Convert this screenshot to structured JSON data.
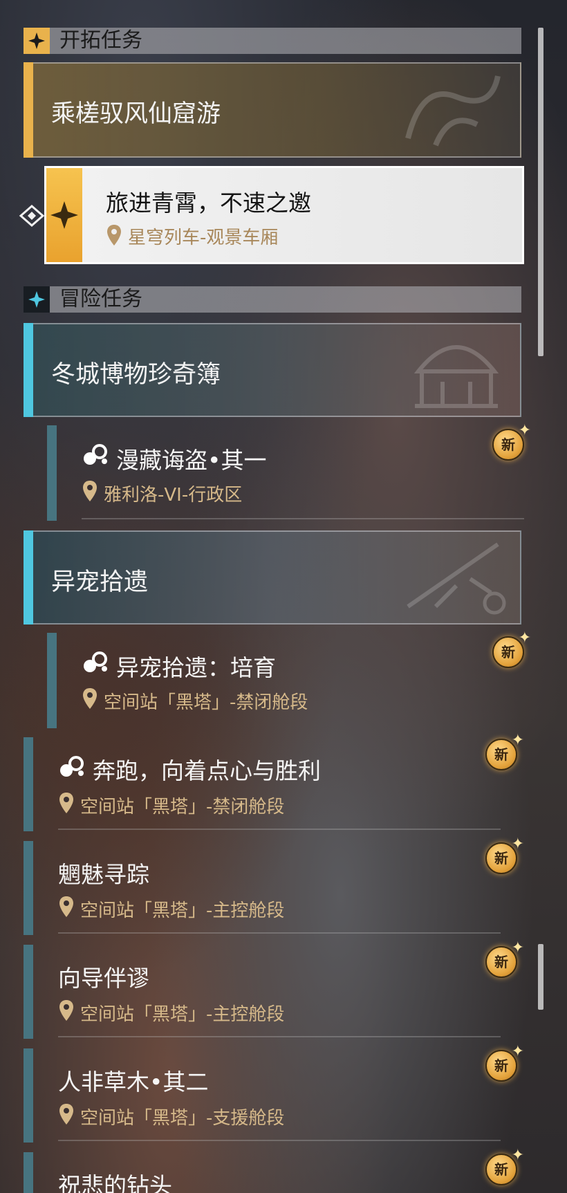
{
  "sections": {
    "trailblaze": {
      "title": "开拓任务"
    },
    "adventure": {
      "title": "冒险任务"
    }
  },
  "trailblaze_group": {
    "title": "乘槎驭风仙窟游"
  },
  "current_task": {
    "name": "旅进青霄，不速之邀",
    "location": "星穹列车-观景车厢"
  },
  "groups": [
    {
      "title": "冬城博物珍奇簿"
    },
    {
      "title": "异宠拾遗"
    }
  ],
  "tasks": [
    {
      "name": "漫藏诲盗•其一",
      "location": "雅利洛-VI-行政区",
      "new": "新"
    },
    {
      "name": "异宠拾遗：培育",
      "location": "空间站「黑塔」-禁闭舱段",
      "new": "新"
    },
    {
      "name": "奔跑，向着点心与胜利",
      "location": "空间站「黑塔」-禁闭舱段",
      "new": "新"
    },
    {
      "name": "魍魅寻踪",
      "location": "空间站「黑塔」-主控舱段",
      "new": "新"
    },
    {
      "name": "向导伴谬",
      "location": "空间站「黑塔」-主控舱段",
      "new": "新"
    },
    {
      "name": "人非草木•其二",
      "location": "空间站「黑塔」-支援舱段",
      "new": "新"
    },
    {
      "name": "祝悲的钻头",
      "location": "",
      "new": "新"
    }
  ],
  "colors": {
    "gold": "#e9b24c",
    "cyan": "#4fc7e0",
    "location_text": "#d6b98a"
  }
}
